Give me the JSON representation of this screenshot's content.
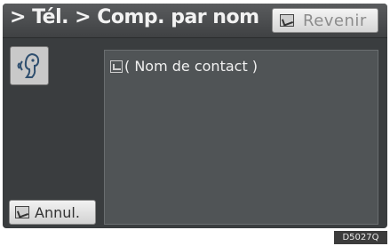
{
  "header": {
    "title": "> Tél. > Comp. par nom",
    "back_label": "Revenir"
  },
  "sidebar": {
    "voice_icon": "voice-command-icon"
  },
  "main": {
    "contact_placeholder": "( Nom de contact )"
  },
  "footer": {
    "cancel_label": "Annul."
  },
  "figure_code": "D5027Q"
}
